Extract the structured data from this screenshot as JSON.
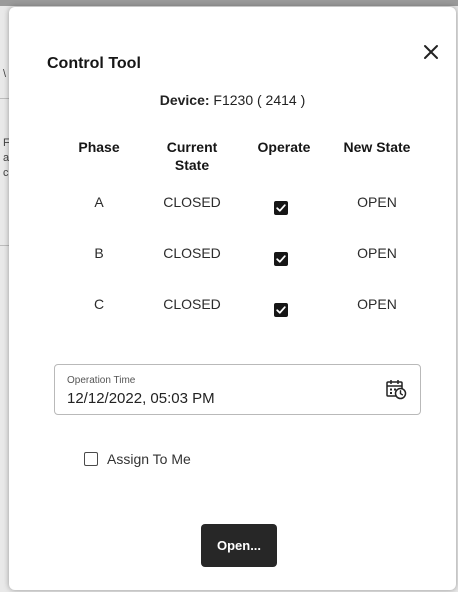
{
  "background": {
    "edge_glyphs": [
      "\\",
      "F",
      "a",
      "c"
    ]
  },
  "dialog": {
    "title": "Control Tool",
    "close_icon": "close-icon",
    "device_label": "Device:",
    "device_value": "F1230 ( 2414 )",
    "table": {
      "headers": {
        "phase": "Phase",
        "current_state_line1": "Current",
        "current_state_line2": "State",
        "operate": "Operate",
        "new_state": "New State"
      },
      "rows": [
        {
          "phase": "A",
          "current_state": "CLOSED",
          "operate_checked": true,
          "new_state": "OPEN"
        },
        {
          "phase": "B",
          "current_state": "CLOSED",
          "operate_checked": true,
          "new_state": "OPEN"
        },
        {
          "phase": "C",
          "current_state": "CLOSED",
          "operate_checked": true,
          "new_state": "OPEN"
        }
      ]
    },
    "operation_time": {
      "label": "Operation Time",
      "value": "12/12/2022, 05:03 PM",
      "icon": "calendar-clock-icon"
    },
    "assign_to_me": {
      "label": "Assign To Me",
      "checked": false
    },
    "open_button_label": "Open..."
  },
  "colors": {
    "button_bg": "#272727",
    "checkbox_fill": "#161616",
    "dialog_bg": "#ffffff"
  }
}
